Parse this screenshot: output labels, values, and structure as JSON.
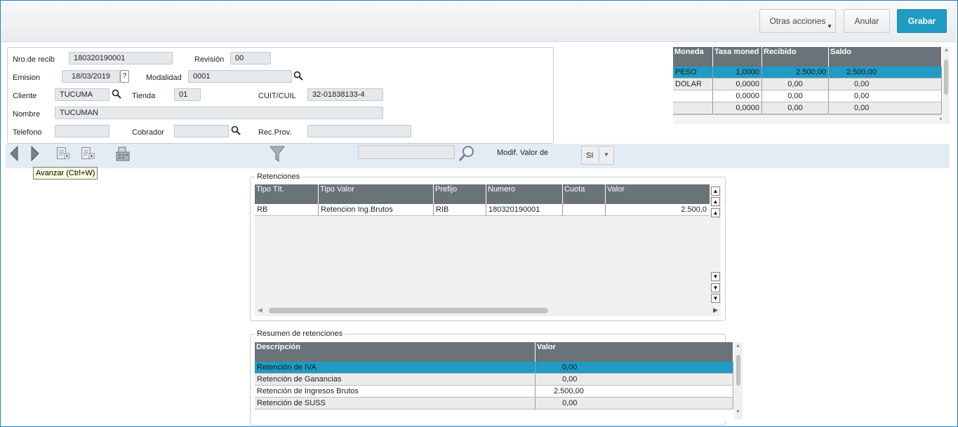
{
  "toolbar": {
    "otras_label": "Otras acciones",
    "anular_label": "Anular",
    "grabar_label": "Grabar"
  },
  "header": {
    "nro_recib_label": "Nro.de recib",
    "nro_recib_value": "180320190001",
    "revision_label": "Revisión",
    "revision_value": "00",
    "emision_label": "Emision",
    "emision_value": "18/03/2019",
    "help_mark": "?",
    "modalidad_label": "Modalidad",
    "modalidad_value": "0001",
    "cliente_label": "Cliente",
    "cliente_value": "TUCUMA",
    "tienda_label": "Tienda",
    "tienda_value": "01",
    "cuit_label": "CUIT/CUIL",
    "cuit_value": "32-01838133-4",
    "nombre_label": "Nombre",
    "nombre_value": "TUCUMAN",
    "telefono_label": "Telefono",
    "telefono_value": "",
    "cobrador_label": "Cobrador",
    "cobrador_value": "",
    "recprov_label": "Rec.Prov.",
    "recprov_value": ""
  },
  "currency_table": {
    "columns": [
      "Moneda",
      "Tasa moned",
      "Recibido",
      "Saldo"
    ],
    "rows": [
      [
        "PESO",
        "1,0000",
        "2.500,00",
        "2.500,00"
      ],
      [
        "DOLAR",
        "0,0000",
        "0,00",
        "0,00"
      ],
      [
        "",
        "0,0000",
        "0,00",
        "0,00"
      ],
      [
        "",
        "0,0000",
        "0,00",
        "0,00"
      ]
    ]
  },
  "navbar": {
    "search_value": "",
    "modif_label": "Modif. Valor de",
    "modif_value": "SI",
    "tooltip": "Avanzar  (Ctrl+W)"
  },
  "retenciones": {
    "legend": "Retenciones",
    "columns": [
      "Tipo Tít.",
      "Tipo Valor",
      "Prefijo",
      "Numero",
      "Cuota",
      "Valor"
    ],
    "rows": [
      [
        "RB",
        "Retencion Ing.Brutos",
        "RIB",
        "180320190001",
        "",
        "2.500,0"
      ]
    ]
  },
  "resumen": {
    "legend": "Resumen de retenciones",
    "columns": [
      "Descripción",
      "Valor"
    ],
    "rows": [
      [
        "Retención de IVA",
        "0,00"
      ],
      [
        "Retención de Ganancias",
        "0,00"
      ],
      [
        "Retención de Ingresos Brutos",
        "2.500,00"
      ],
      [
        "Retención de SUSS",
        "0,00"
      ]
    ]
  },
  "colors": {
    "accent": "#1f9bc4",
    "grid_header": "#6a7378",
    "toolbar_bg": "#e3ebf3"
  }
}
